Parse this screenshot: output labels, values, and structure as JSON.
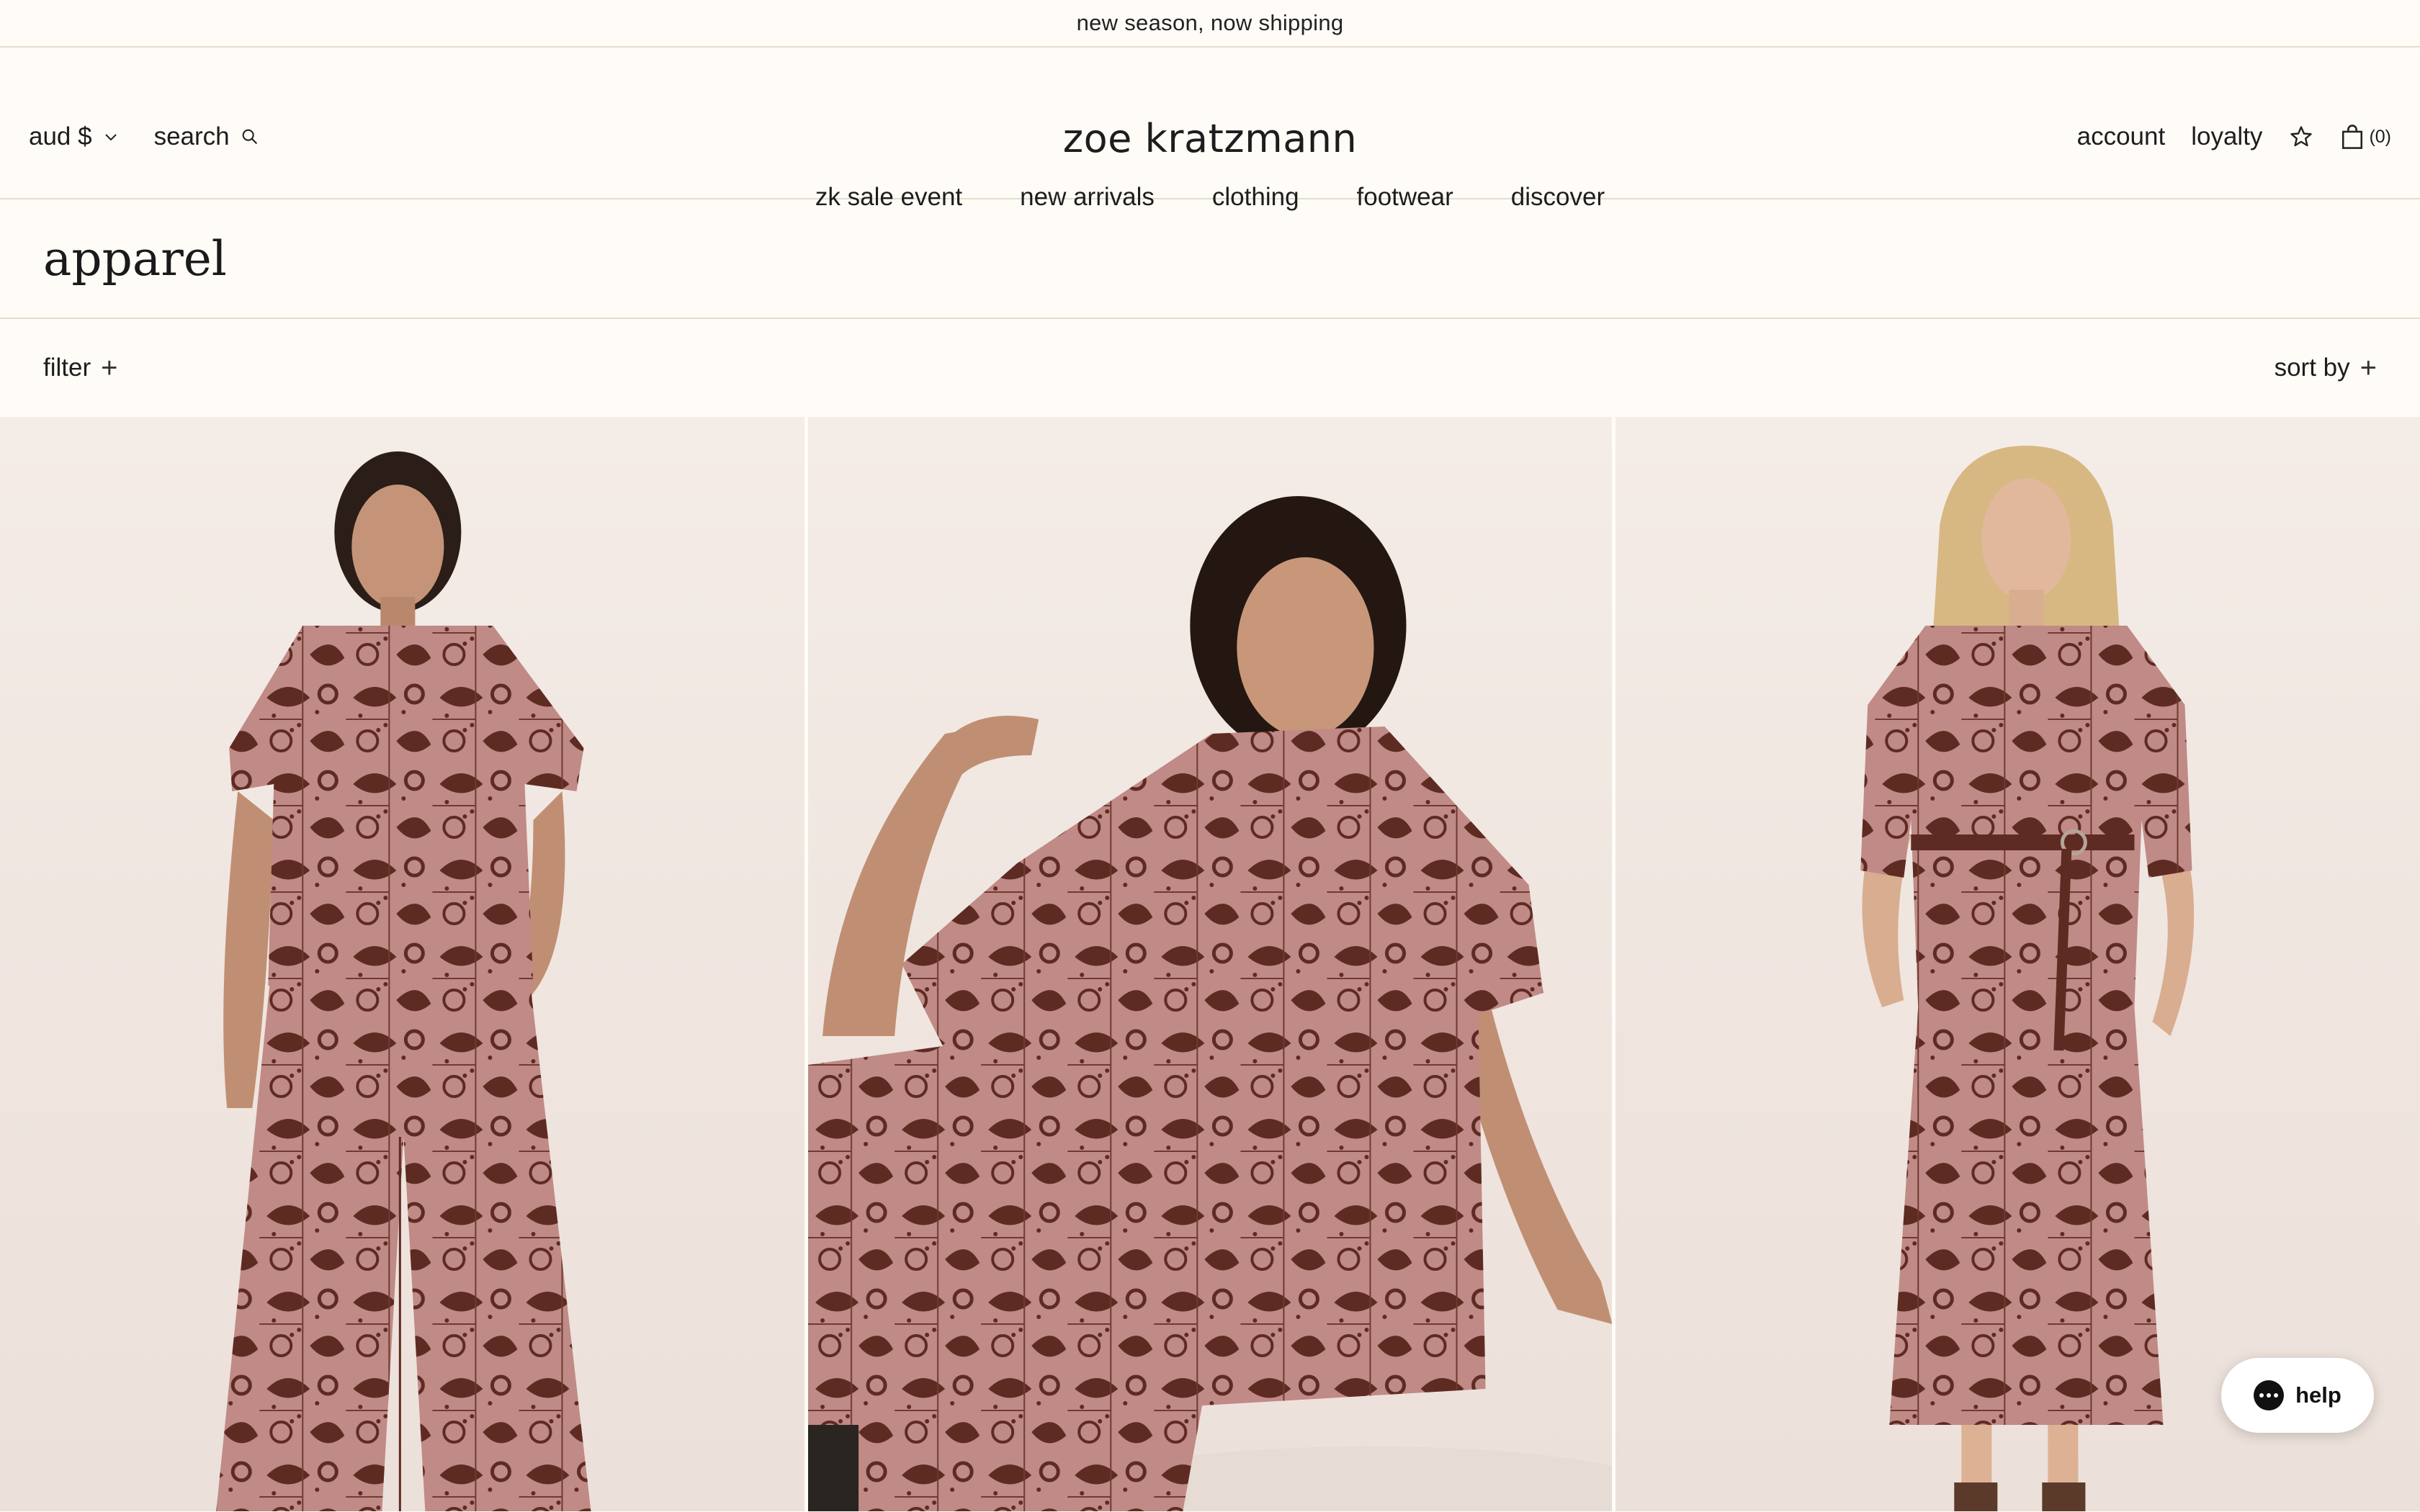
{
  "announcement": "new season, now shipping",
  "header": {
    "currency": "aud $",
    "search": "search",
    "logo": "zoe kratzmann",
    "account": "account",
    "loyalty": "loyalty",
    "cart_count": "(0)"
  },
  "nav": {
    "items": [
      {
        "label": "zk sale event"
      },
      {
        "label": "new arrivals"
      },
      {
        "label": "clothing"
      },
      {
        "label": "footwear"
      },
      {
        "label": "discover"
      }
    ]
  },
  "page": {
    "title": "apparel"
  },
  "toolbar": {
    "filter": "filter",
    "sort": "sort by"
  },
  "products": [
    {
      "image": "model wearing brown print short-sleeve shirt and wide-leg pants"
    },
    {
      "image": "model seated wearing brown print short-sleeve shirt"
    },
    {
      "image": "model wearing brown print belted shirt dress"
    }
  ],
  "help": {
    "label": "help"
  },
  "colors": {
    "background": "#fffcf7",
    "border": "#e4dccd",
    "print_base": "#c08a86",
    "print_dark": "#5e2b22"
  }
}
